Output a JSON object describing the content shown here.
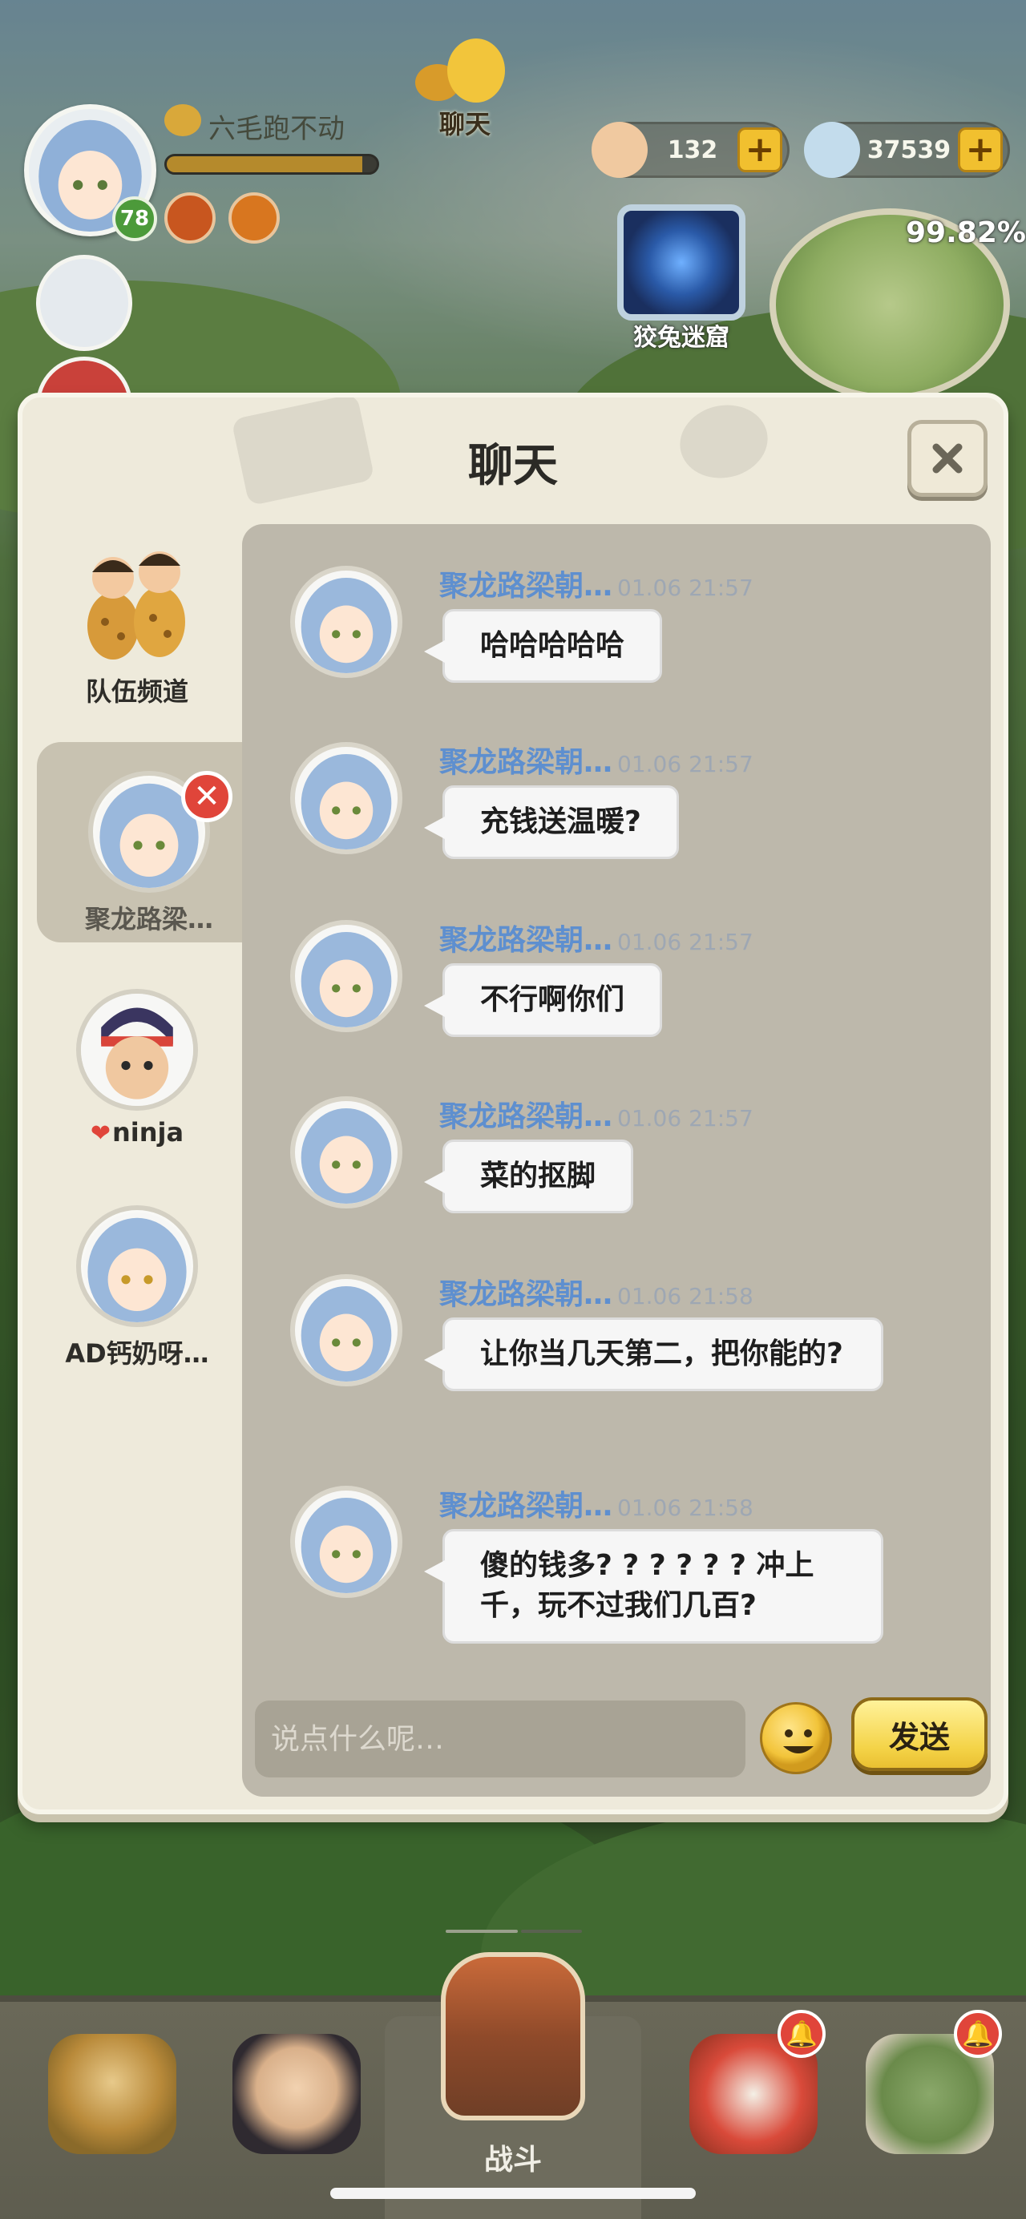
{
  "hud": {
    "player_name": "六毛跑不动",
    "level": "78",
    "chat_label": "聊天",
    "coins": "132",
    "gems": "37539",
    "plus": "+",
    "cave_label": "狡兔迷窟",
    "map_percent": "99.82%",
    "exp_fraction": 0.93
  },
  "panel": {
    "title": "聊天",
    "close_symbol": "✕"
  },
  "channels": [
    {
      "label": "队伍频道"
    },
    {
      "label": "聚龙路梁…",
      "remove_symbol": "✕"
    },
    {
      "label": "ninja",
      "heart": "❤"
    },
    {
      "label": "AD钙奶呀…"
    }
  ],
  "messages": [
    {
      "name": "聚龙路梁朝…",
      "time": "01.06 21:57",
      "text": "哈哈哈哈哈"
    },
    {
      "name": "聚龙路梁朝…",
      "time": "01.06 21:57",
      "text": "充钱送温暖?"
    },
    {
      "name": "聚龙路梁朝…",
      "time": "01.06 21:57",
      "text": "不行啊你们"
    },
    {
      "name": "聚龙路梁朝…",
      "time": "01.06 21:57",
      "text": "菜的抠脚"
    },
    {
      "name": "聚龙路梁朝…",
      "time": "01.06 21:58",
      "text": "让你当几天第二，把你能的?"
    },
    {
      "name": "聚龙路梁朝…",
      "time": "01.06 21:58",
      "text": "傻的钱多? ? ? ? ? ? 冲上千，玩不过我们几百?"
    }
  ],
  "input": {
    "placeholder": "说点什么呢…"
  },
  "send_label": "发送",
  "bottom_nav": {
    "battle_label": "战斗",
    "bell_symbol": "🔔"
  },
  "colors": {
    "name_blue": "#5e8fcf",
    "send_yellow": "#f4d347",
    "badge_red": "#e0453a"
  }
}
